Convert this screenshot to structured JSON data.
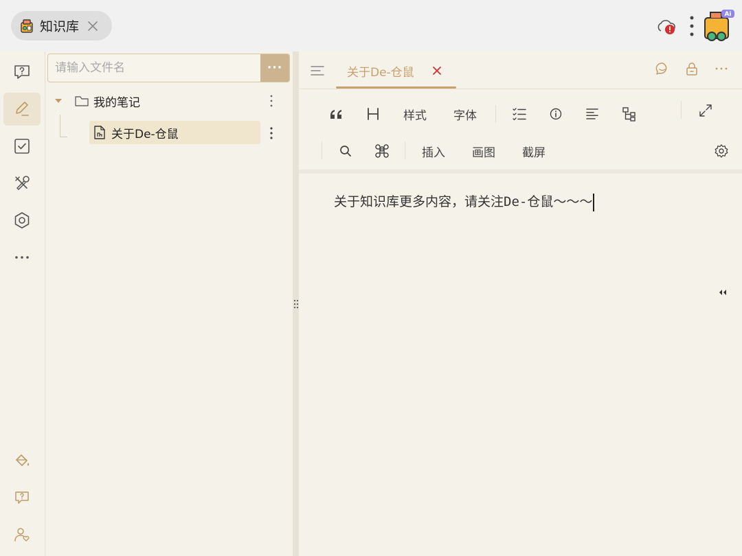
{
  "titlebar": {
    "app_tab_label": "知识库",
    "avatar_badge": "Ai"
  },
  "rail": {
    "items": [
      "help-icon",
      "edit-icon",
      "checkbox-icon",
      "tools-icon",
      "settings-hex-icon",
      "more-icon"
    ],
    "bottom": [
      "paint-bucket-icon",
      "feedback-icon",
      "user-icon"
    ]
  },
  "file_panel": {
    "search_placeholder": "请输入文件名",
    "more_label": "···",
    "folder_label": "我的笔记",
    "file_label": "关于De-仓鼠"
  },
  "editor": {
    "tab_label": "关于De-仓鼠",
    "toolbar": {
      "style_label": "样式",
      "font_label": "字体",
      "insert_label": "插入",
      "draw_label": "画图",
      "screenshot_label": "截屏"
    },
    "content_text": "关于知识库更多内容，请关注De-仓鼠～～～"
  },
  "colors": {
    "accent": "#c9a06c",
    "panel_bg": "#f5f2ea",
    "topbar_bg": "#f1f1f1",
    "active_rail": "#ece3d0",
    "error_red": "#d32f2f"
  }
}
